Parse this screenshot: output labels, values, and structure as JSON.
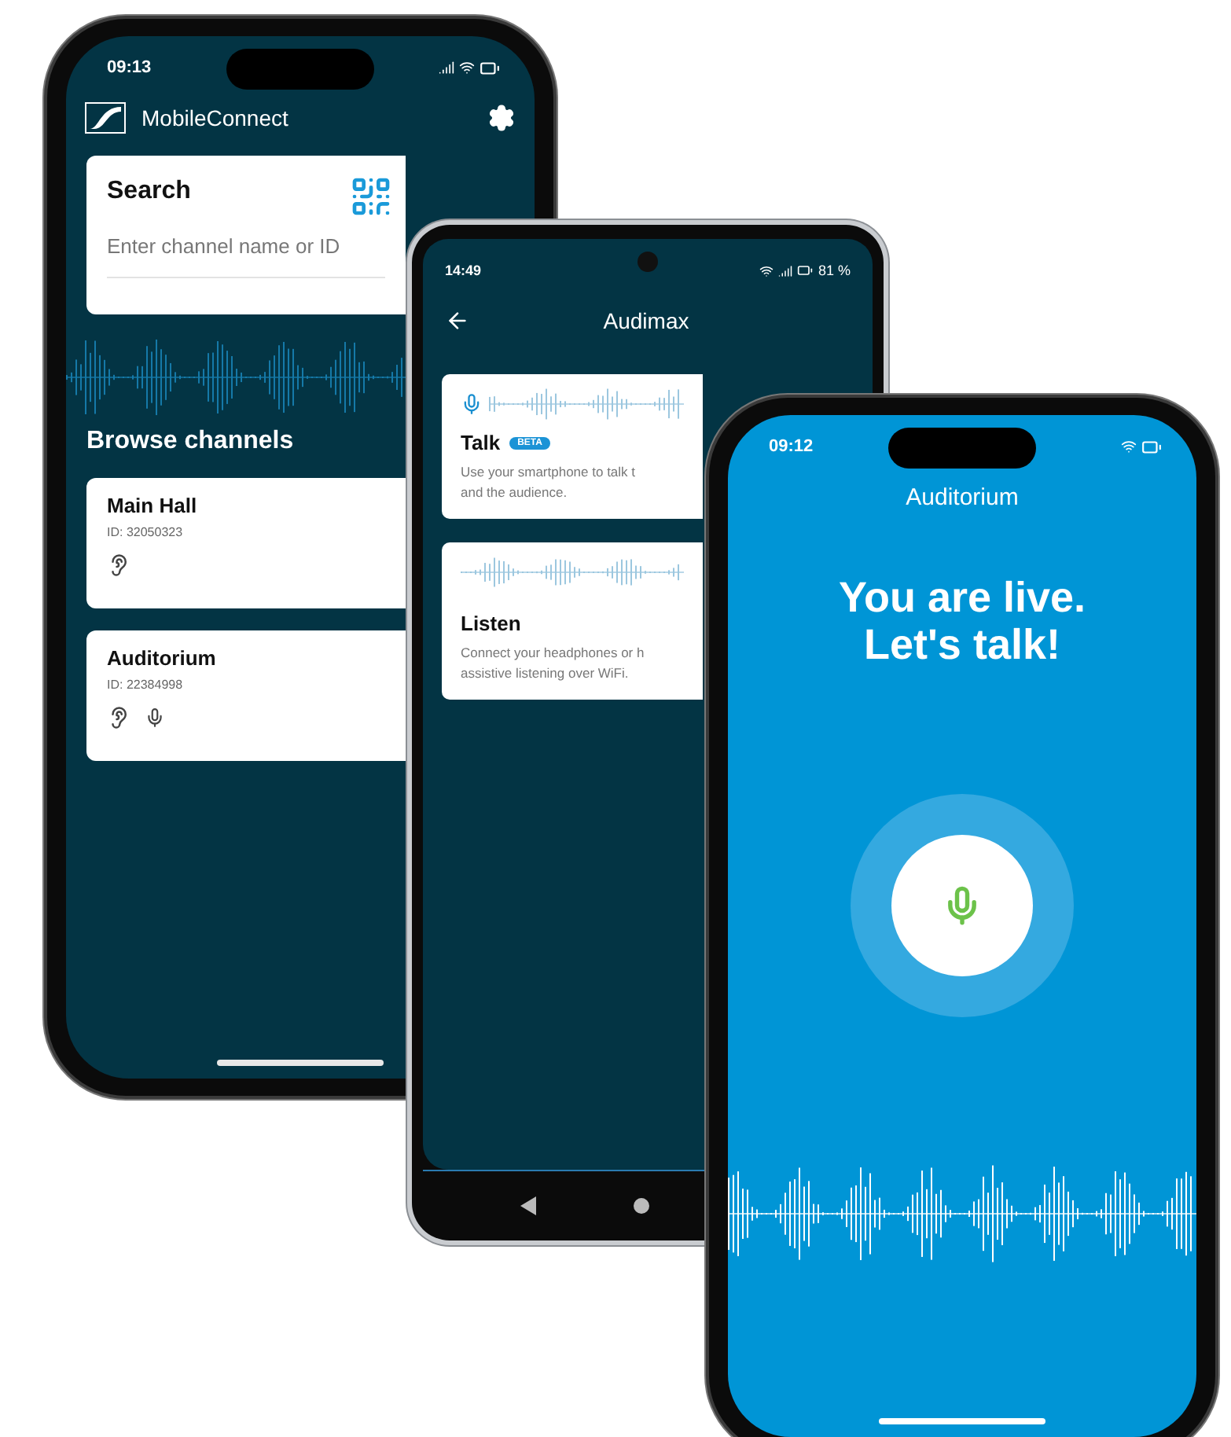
{
  "phones": [
    {
      "kind": "channel_list",
      "status": {
        "time": "09:13"
      },
      "app_title": "MobileConnect",
      "search": {
        "title": "Search",
        "placeholder": "Enter channel name or ID"
      },
      "section_title": "Browse channels",
      "channels": [
        {
          "name": "Main Hall",
          "id": "ID: 32050323",
          "listen": true,
          "talk": false
        },
        {
          "name": "Auditorium",
          "id": "ID: 22384998",
          "listen": true,
          "talk": true
        }
      ]
    },
    {
      "kind": "channel_detail",
      "status": {
        "time": "14:49",
        "battery": "81 %"
      },
      "title": "Audimax",
      "modes": [
        {
          "kind": "talk",
          "title": "Talk",
          "badge": "BETA",
          "description": "Use your smartphone to talk t\nand the audience."
        },
        {
          "kind": "listen",
          "title": "Listen",
          "description": "Connect your headphones or h\nassistive listening over WiFi."
        }
      ]
    },
    {
      "kind": "live",
      "status": {
        "time": "09:12"
      },
      "channel": "Auditorium",
      "headline": "You are live.\nLet's talk!"
    }
  ]
}
